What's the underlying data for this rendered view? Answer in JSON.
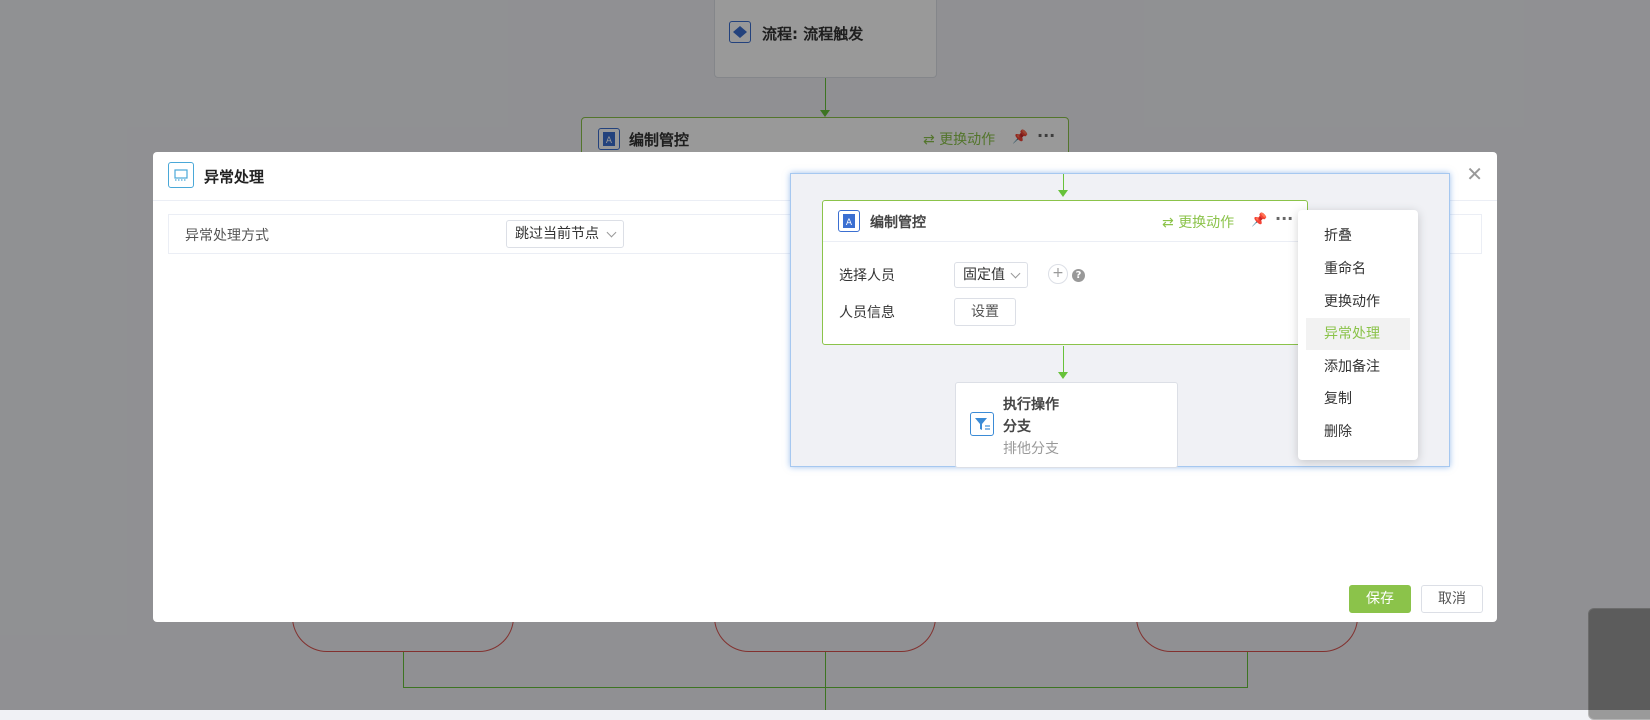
{
  "background": {
    "trigger_node": {
      "title": "流程: 流程触发",
      "icon": "layers-icon"
    },
    "control_node": {
      "title": "编制管控",
      "icon": "document-a-icon",
      "change_action": "更换动作",
      "pin_icon": "pin-icon",
      "more_icon": "more-icon"
    }
  },
  "modal": {
    "title": "异常处理",
    "icon": "monitor-icon",
    "close_icon": "close-icon",
    "field": {
      "label": "异常处理方式",
      "value": "跳过当前节点"
    },
    "save_label": "保存",
    "cancel_label": "取消"
  },
  "preview": {
    "node": {
      "title": "编制管控",
      "icon": "document-a-icon",
      "change_action": "更换动作",
      "select_person_label": "选择人员",
      "select_person_value": "固定值",
      "plus": "+",
      "help": "?",
      "person_info_label": "人员信息",
      "set_button": "设置"
    },
    "branch_node": {
      "icon": "filter-icon",
      "line1": "执行操作",
      "line2": "分支",
      "line3": "排他分支"
    }
  },
  "context_menu": {
    "items": [
      "折叠",
      "重命名",
      "更换动作",
      "异常处理",
      "添加备注",
      "复制",
      "删除"
    ],
    "active_index": 3
  },
  "colors": {
    "accent_green": "#8bc34a",
    "connector_green": "#67c23a",
    "icon_blue": "#3b6fd1",
    "branch_red": "#d9534f"
  }
}
